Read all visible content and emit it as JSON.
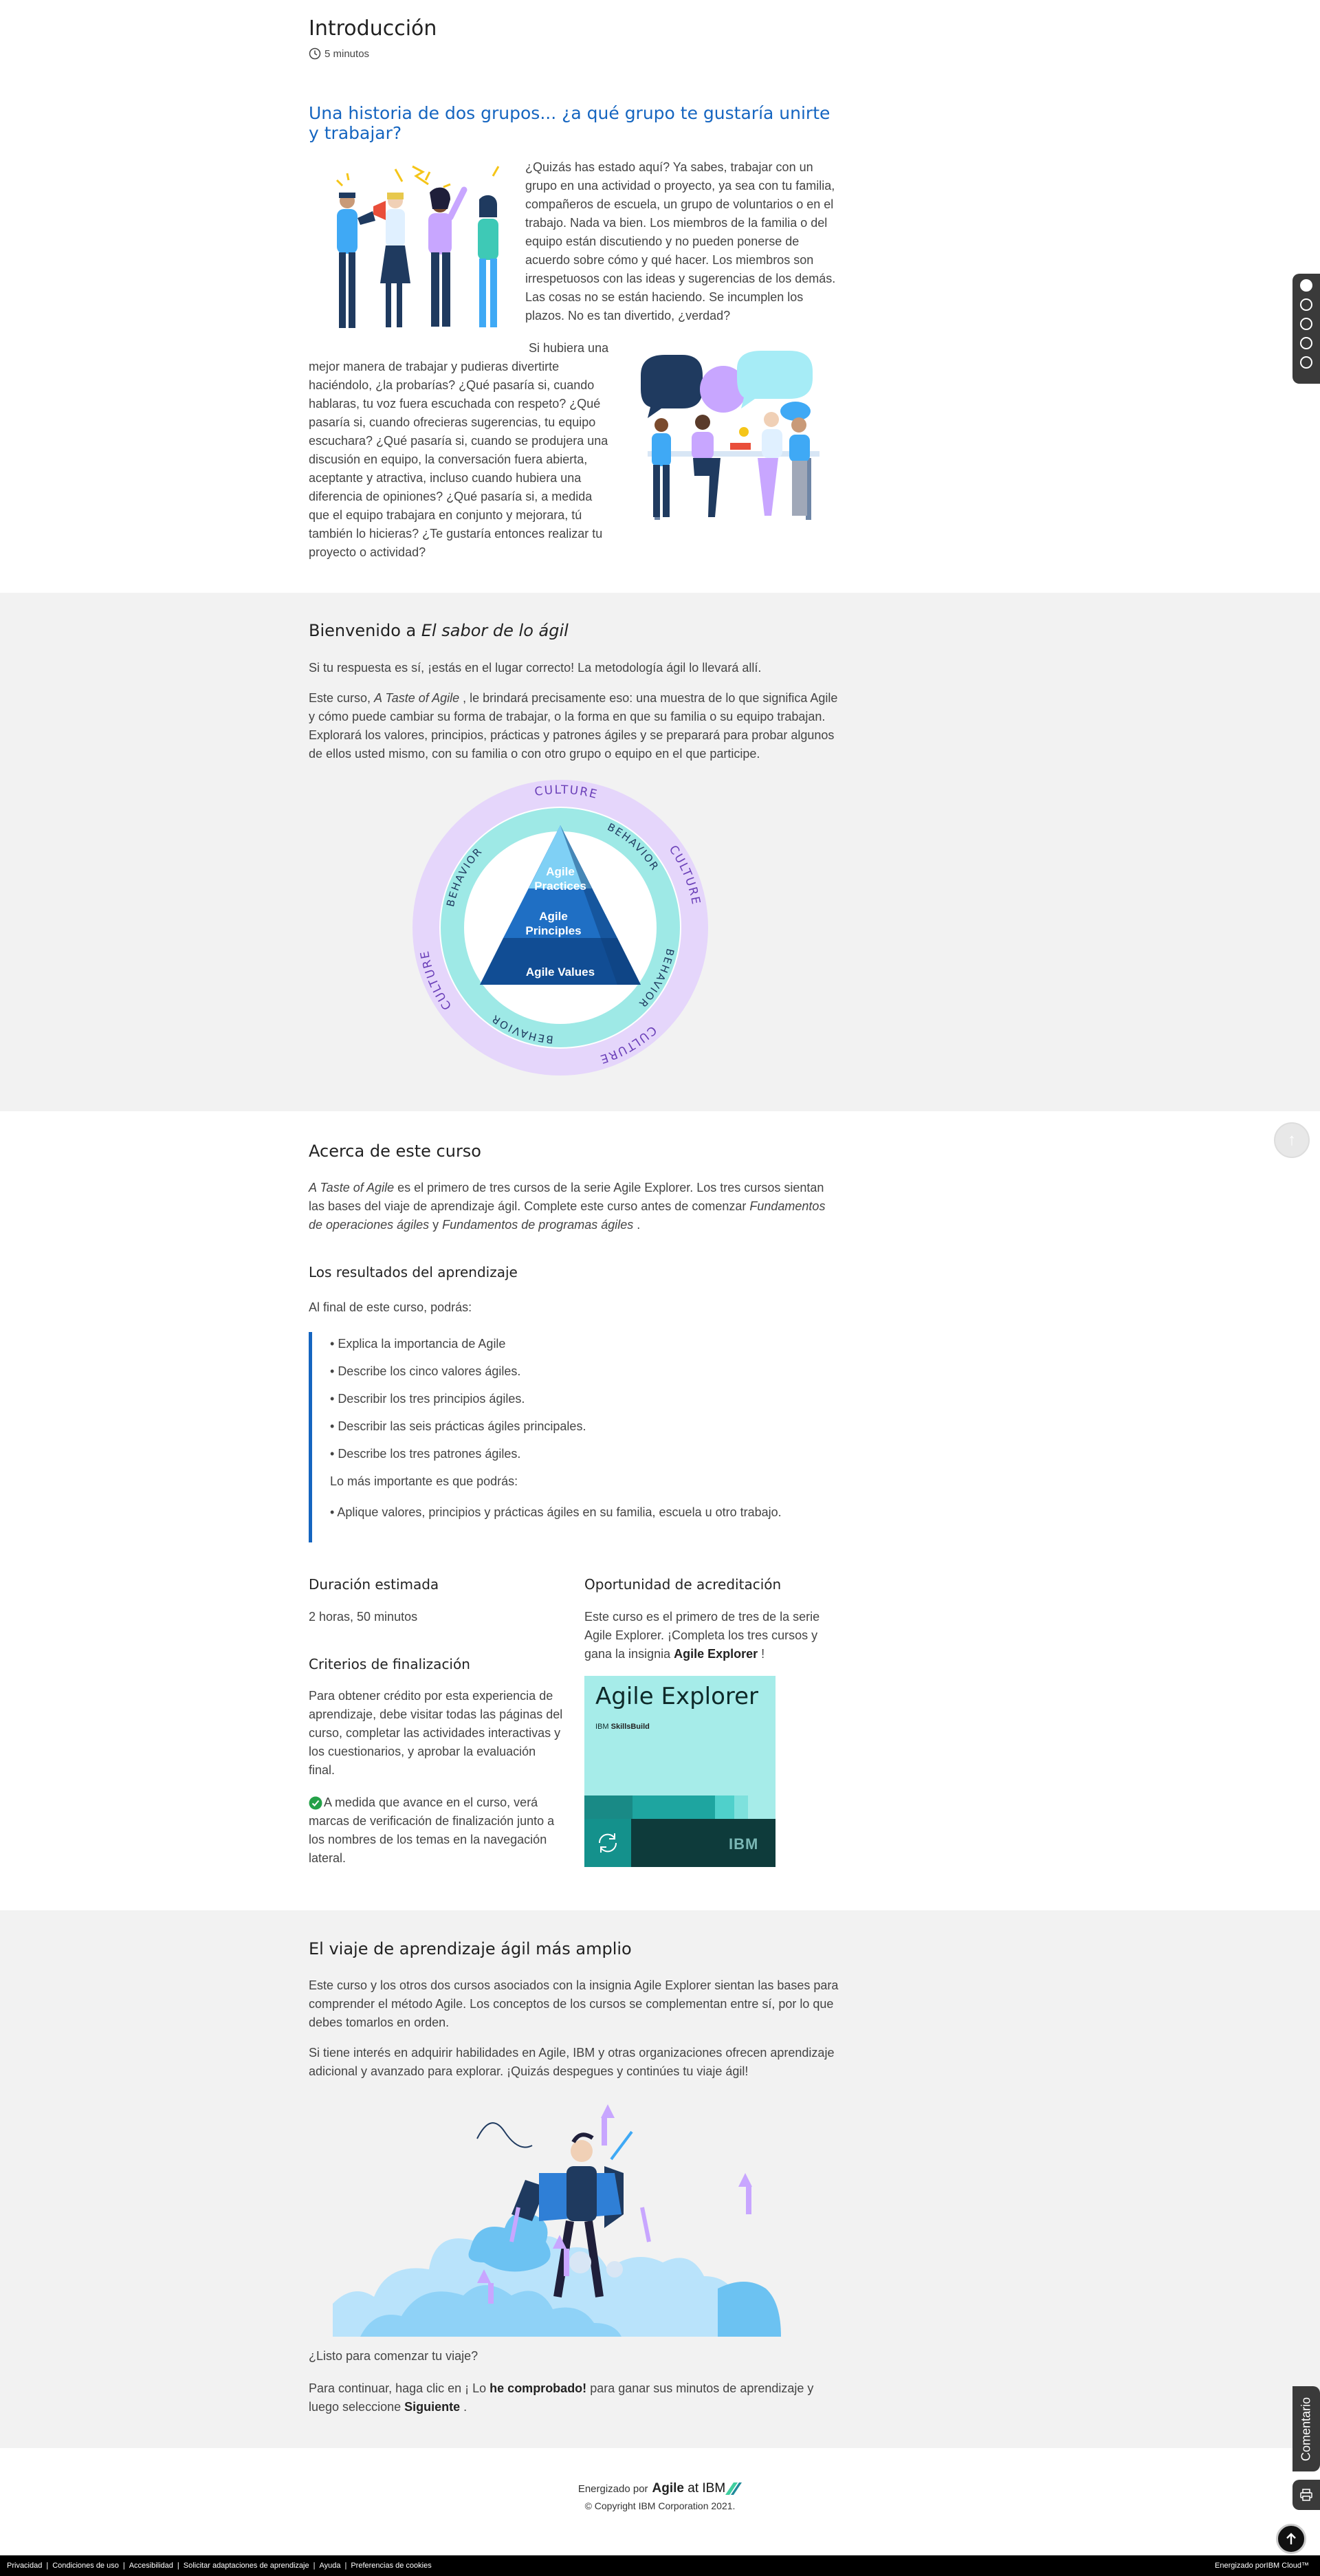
{
  "header": {
    "title": "Introducción",
    "duration": "5 minutos"
  },
  "story": {
    "heading": "Una historia de dos grupos... ¿a qué grupo te gustaría unirte y trabajar?",
    "p1": "¿Quizás has estado aquí? Ya sabes, trabajar con un grupo en una actividad o proyecto, ya sea con tu familia, compañeros de escuela, un grupo de voluntarios o en el trabajo. Nada va bien. Los miembros de la familia o del equipo están discutiendo y no pueden ponerse de acuerdo sobre cómo y qué hacer. Los miembros son irrespetuosos con las ideas y sugerencias de los demás. Las cosas no se están haciendo. Se incumplen los plazos. No es tan divertido, ¿verdad?",
    "p2": "Si hubiera una mejor manera de trabajar y pudieras divertirte haciéndolo, ¿la probarías? ¿Qué pasaría si, cuando hablaras, tu voz fuera escuchada con respeto? ¿Qué pasaría si, cuando ofrecieras sugerencias, tu equipo escuchara? ¿Qué pasaría si, cuando se produjera una discusión en equipo, la conversación fuera abierta, aceptante y atractiva, incluso cuando hubiera una diferencia de opiniones? ¿Qué pasaría si, a medida que el equipo trabajara en conjunto y mejorara, tú también lo hicieras? ¿Te gustaría entonces realizar tu proyecto o actividad?"
  },
  "welcome": {
    "heading_prefix": "Bienvenido a ",
    "heading_em": "El sabor de lo ágil",
    "p1": "Si tu respuesta es sí, ¡estás en el lugar correcto! La metodología ágil lo llevará allí.",
    "p2_a": "Este curso, ",
    "p2_em": "A Taste of Agile",
    "p2_b": " , le brindará precisamente eso: una muestra de lo que significa Agile y cómo puede cambiar su forma de trabajar, o la forma en que su familia o su equipo trabajan. Explorará los valores, principios, prácticas y patrones ágiles y se preparará para probar algunos de ellos usted mismo, con su familia o con otro grupo o equipo en el que participe.",
    "diagram": {
      "culture": "CULTURE",
      "behavior": "BEHAVIOR",
      "practices": "Agile Practices",
      "principles": "Agile Principles",
      "values": "Agile Values"
    }
  },
  "about": {
    "heading": "Acerca de este curso",
    "p_em1": "A Taste of Agile",
    "p_a": " es el primero de tres cursos de la serie Agile Explorer. Los tres cursos sientan las bases del viaje de aprendizaje ágil. Complete este curso antes de comenzar ",
    "p_em2": "Fundamentos de operaciones ágiles",
    "p_b": " y ",
    "p_em3": "Fundamentos de programas ágiles",
    "p_c": " .",
    "outcomes_heading": "Los resultados del aprendizaje",
    "outcomes_intro": "Al final de este curso, podrás:",
    "outcomes": [
      "Explica la importancia de Agile",
      "Describe los cinco valores ágiles.",
      "Describir los tres principios ágiles.",
      "Describir las seis prácticas ágiles principales.",
      "Describe los tres patrones ágiles."
    ],
    "most_important": "Lo más importante es que podrás:",
    "most_important_item": "Aplique valores, principios y prácticas ágiles en su familia, escuela u otro trabajo.",
    "duration_heading": "Duración estimada",
    "duration_value": "2 horas, 50 minutos",
    "completion_heading": "Criterios de finalización",
    "completion_p1": "Para obtener crédito por esta experiencia de aprendizaje, debe visitar todas las páginas del curso, completar las actividades interactivas y los cuestionarios, y aprobar la evaluación final.",
    "completion_p2": "A medida que avance en el curso, verá marcas de verificación de finalización junto a los nombres de los temas en la navegación lateral.",
    "credential_heading": "Oportunidad de acreditación",
    "credential_p_a": "Este curso es el primero de tres de la serie Agile Explorer. ¡Completa los tres cursos y gana la insignia ",
    "credential_p_b": "Agile Explorer",
    "credential_p_c": " !",
    "badge_title": "Agile Explorer",
    "badge_sub_a": "IBM",
    "badge_sub_b": "SkillsBuild",
    "badge_logo": "IBM"
  },
  "journey": {
    "heading": "El viaje de aprendizaje ágil más amplio",
    "p1": "Este curso y los otros dos cursos asociados con la insignia Agile Explorer sientan las bases para comprender el método Agile. Los conceptos de los cursos se complementan entre sí, por lo que debes tomarlos en orden.",
    "p2": "Si tiene interés en adquirir habilidades en Agile, IBM y otras organizaciones ofrecen aprendizaje adicional y avanzado para explorar. ¡Quizás despegues y continúes tu viaje ágil!",
    "ready": "¿Listo para comenzar tu viaje?",
    "continue_a": "Para continuar, haga clic en ¡ Lo ",
    "continue_b": "he comprobado!",
    "continue_c": " para ganar sus minutos de aprendizaje y luego seleccione ",
    "continue_d": "Siguiente",
    "continue_e": " ."
  },
  "page_footer": {
    "powered_by": "Energizado por",
    "brand_a": "Agile",
    "brand_b": " at IBM",
    "copyright": "© Copyright IBM Corporation 2021."
  },
  "side": {
    "comment": "Comentario"
  },
  "bottom_bar": {
    "links": [
      "Privacidad",
      "Condiciones de uso",
      "Accesibilidad",
      "Solicitar adaptaciones de aprendizaje",
      "Ayuda",
      "Preferencias de cookies"
    ],
    "powered": "Energizado porIBM Cloud™"
  },
  "colors": {
    "accent": "#1565c0",
    "band": "#f2f2f2",
    "badge_teal": "#a6ece9",
    "badge_dark": "#0e3b3b"
  }
}
